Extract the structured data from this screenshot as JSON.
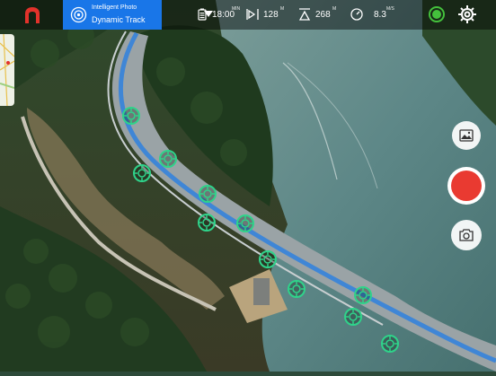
{
  "mode": {
    "title": "Intelligent Photo",
    "value": "Dynamic Track"
  },
  "telemetry": [
    {
      "icon": "battery-icon",
      "value": "18:00",
      "unit": "MIN"
    },
    {
      "icon": "distance-icon",
      "value": "128",
      "unit": "M"
    },
    {
      "icon": "altitude-icon",
      "value": "268",
      "unit": "M"
    },
    {
      "icon": "speed-icon",
      "value": "8.3",
      "unit": "M/S"
    }
  ],
  "colors": {
    "accent": "#1976e8",
    "shutter": "#e93a31",
    "logo": "#e2322b",
    "signal": "#44c13c",
    "marker": "#2fd38a"
  },
  "tracked_object_count": 11
}
